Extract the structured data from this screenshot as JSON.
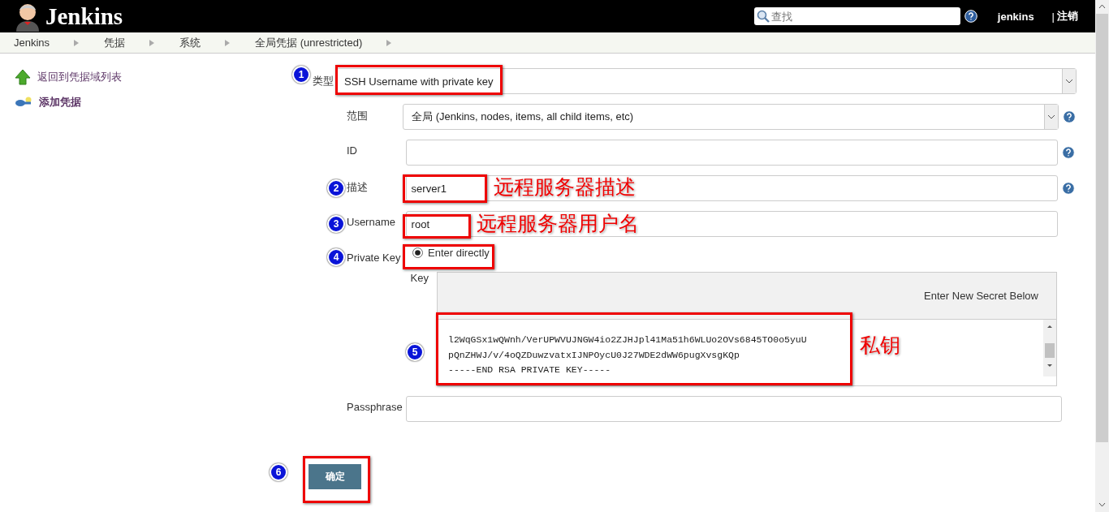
{
  "header": {
    "logo_text": "Jenkins",
    "search": {
      "placeholder": "查找"
    },
    "user": "jenkins",
    "separator": "|",
    "logout": "注销"
  },
  "breadcrumbs": [
    "Jenkins",
    "凭据",
    "系统",
    "全局凭据 (unrestricted)"
  ],
  "sidebar": {
    "items": [
      {
        "label": "返回到凭据域列表",
        "kind": "back",
        "selected": false
      },
      {
        "label": "添加凭据",
        "kind": "add",
        "selected": true
      }
    ]
  },
  "form": {
    "type": {
      "label": "类型",
      "value": "SSH Username with private key"
    },
    "fields": [
      {
        "label": "范围",
        "kind": "select",
        "value": "全局 (Jenkins, nodes, items, all child items, etc)",
        "help": true
      },
      {
        "label": "ID",
        "kind": "text",
        "help": true
      },
      {
        "label": "描述",
        "kind": "text",
        "value": "server1",
        "help": true
      },
      {
        "label": "Username",
        "kind": "text",
        "value": "root",
        "help": false
      }
    ],
    "private_key": {
      "label": "Private Key",
      "option": {
        "label": "Enter directly",
        "selected": true
      },
      "key_label": "Key",
      "hint": "Enter New Secret Below",
      "lines": [
        "l2WqGSx1wQWnh/VerUPWVUJNGW4io2ZJHJpl41Ma51h6WLUo2OVs6845TO0o5yuU",
        "pQnZHWJ/v/4oQZDuwzvatxIJNPOycU0J27WDE2dWW6pugXvsgKQp",
        "-----END RSA PRIVATE KEY-----"
      ]
    },
    "passphrase": {
      "label": "Passphrase"
    },
    "submit": "确定"
  },
  "annotations": [
    {
      "number": "1"
    },
    {
      "number": "2",
      "caption": "远程服务器描述"
    },
    {
      "number": "3",
      "caption": "远程服务器用户名"
    },
    {
      "number": "4"
    },
    {
      "number": "5",
      "caption": "私钥"
    },
    {
      "number": "6"
    }
  ]
}
